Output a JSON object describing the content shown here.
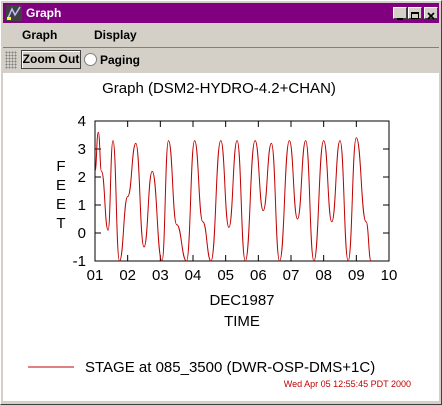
{
  "window": {
    "title": "Graph"
  },
  "menu": {
    "items": [
      "Graph",
      "Display"
    ]
  },
  "toolbar": {
    "zoom_out_label": "Zoom Out",
    "paging_label": "Paging",
    "paging_checked": false
  },
  "colors": {
    "titlebar": "#800080",
    "series": "#c00000",
    "timestamp": "#c00000"
  },
  "icons": [
    "app-icon",
    "minimize-icon",
    "maximize-icon",
    "close-icon"
  ],
  "chart_data": {
    "type": "line",
    "title": "Graph (DSM2-HYDRO-4.2+CHAN)",
    "xlabel_lines": [
      "DEC1987",
      "TIME"
    ],
    "ylabel": "FEET",
    "xlim": [
      1,
      10
    ],
    "ylim": [
      -1,
      4
    ],
    "xticks": [
      "01",
      "02",
      "03",
      "04",
      "05",
      "06",
      "07",
      "08",
      "09",
      "10"
    ],
    "yticks": [
      "4",
      "3",
      "2",
      "1",
      "0",
      "-1"
    ],
    "grid": false,
    "legend_position": "bottom",
    "series": [
      {
        "name": "STAGE at 085_3500 (DWR-OSP-DMS+1C)",
        "x": [
          1.0,
          1.1,
          1.2,
          1.4,
          1.55,
          1.75,
          2.0,
          2.25,
          2.5,
          2.75,
          3.05,
          3.25,
          3.5,
          3.8,
          4.05,
          4.3,
          4.55,
          4.85,
          5.1,
          5.35,
          5.6,
          5.9,
          6.15,
          6.4,
          6.65,
          6.95,
          7.2,
          7.45,
          7.7,
          8.0,
          8.25,
          8.5,
          8.75,
          9.0,
          9.3,
          9.45
        ],
        "y": [
          2.2,
          3.6,
          2.2,
          0.1,
          3.3,
          -1.0,
          1.3,
          3.2,
          -0.5,
          2.2,
          -1.0,
          3.3,
          0.3,
          -1.0,
          3.3,
          0.4,
          -1.0,
          3.3,
          0.2,
          3.3,
          -1.0,
          3.3,
          0.8,
          3.2,
          -1.0,
          3.3,
          0.5,
          3.3,
          -1.0,
          3.3,
          0.4,
          3.3,
          -1.0,
          3.4,
          0.4,
          -1.0
        ]
      }
    ],
    "timestamp": "Wed Apr 05 12:55:45 PDT 2000"
  }
}
